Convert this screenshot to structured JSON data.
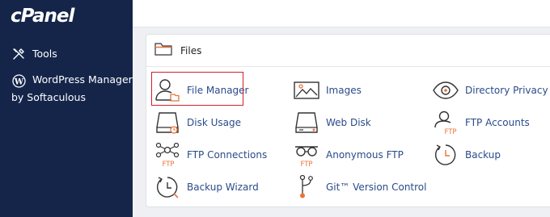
{
  "sidebar": {
    "logo": "cPanel",
    "items": [
      {
        "label": "Tools",
        "icon": "tools-icon"
      },
      {
        "label": "WordPress Manager",
        "label2": "by Softaculous",
        "icon": "wordpress-icon"
      }
    ]
  },
  "files": {
    "title": "Files",
    "items": [
      {
        "label": "File Manager",
        "icon": "file-manager-icon",
        "highlighted": true
      },
      {
        "label": "Images",
        "icon": "images-icon"
      },
      {
        "label": "Directory Privacy",
        "icon": "eye-icon"
      },
      {
        "label": "Disk Usage",
        "icon": "disk-usage-icon"
      },
      {
        "label": "Web Disk",
        "icon": "web-disk-icon"
      },
      {
        "label": "FTP Accounts",
        "icon": "ftp-accounts-icon"
      },
      {
        "label": "FTP Connections",
        "icon": "ftp-connections-icon"
      },
      {
        "label": "Anonymous FTP",
        "icon": "anonymous-ftp-icon"
      },
      {
        "label": "Backup",
        "icon": "backup-icon"
      },
      {
        "label": "Backup Wizard",
        "icon": "backup-wizard-icon"
      },
      {
        "label": "Git™ Version Control",
        "icon": "git-icon"
      }
    ]
  },
  "colors": {
    "sidebar": "#15254a",
    "link": "#2a4a8a",
    "accent": "#e8743b",
    "highlight": "#d0202a"
  }
}
